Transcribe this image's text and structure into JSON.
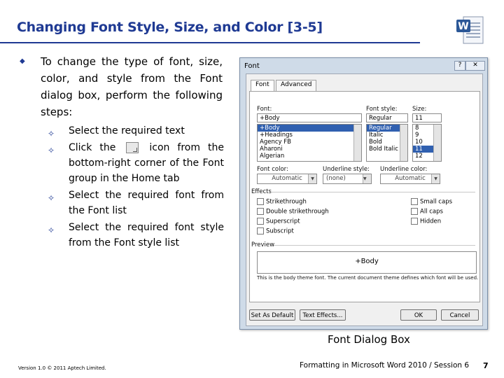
{
  "slide": {
    "title": "Changing Font Style, Size, and Color [3-5]",
    "intro": "To change the type of font, size, color, and style from the Font dialog box, perform the following steps:",
    "steps": [
      {
        "before": "Select the required text",
        "after": ""
      },
      {
        "before": "Click the",
        "after": "icon from the bottom-right corner of the Font group in the Home tab"
      },
      {
        "before": "Select the required font from the Font list",
        "after": ""
      },
      {
        "before": "Select the required font style from the Font style list",
        "after": ""
      }
    ],
    "caption": "Font Dialog Box"
  },
  "dialog": {
    "title": "Font",
    "help": "?",
    "close": "✕",
    "tabs": [
      "Font",
      "Advanced"
    ],
    "font_label": "Font:",
    "font_value": "+Body",
    "font_list": [
      "+Body",
      "+Headings",
      "Agency FB",
      "Aharoni",
      "Algerian"
    ],
    "style_label": "Font style:",
    "style_value": "Regular",
    "style_list": [
      "Regular",
      "Italic",
      "Bold",
      "Bold Italic"
    ],
    "size_label": "Size:",
    "size_value": "11",
    "size_list": [
      "8",
      "9",
      "10",
      "11",
      "12"
    ],
    "color_label": "Font color:",
    "color_value": "Automatic",
    "underline_style_label": "Underline style:",
    "underline_style_value": "(none)",
    "underline_color_label": "Underline color:",
    "underline_color_value": "Automatic",
    "effects_label": "Effects",
    "effects_left": [
      "Strikethrough",
      "Double strikethrough",
      "Superscript",
      "Subscript"
    ],
    "effects_right": [
      "Small caps",
      "All caps",
      "Hidden"
    ],
    "preview_label": "Preview",
    "preview_text": "+Body",
    "preview_note": "This is the body theme font. The current document theme defines which font will be used.",
    "buttons": [
      "Set As Default",
      "Text Effects...",
      "OK",
      "Cancel"
    ]
  },
  "footer": {
    "left": "Version 1.0 © 2011 Aptech Limited.",
    "right": "Formatting in Microsoft Word 2010 / Session 6",
    "page": "7"
  },
  "colors": {
    "accent": "#1f3a93"
  },
  "icons": {
    "bullet": "diamond",
    "sub_bullet": "four-point-star",
    "logo": "word-document-icon"
  }
}
